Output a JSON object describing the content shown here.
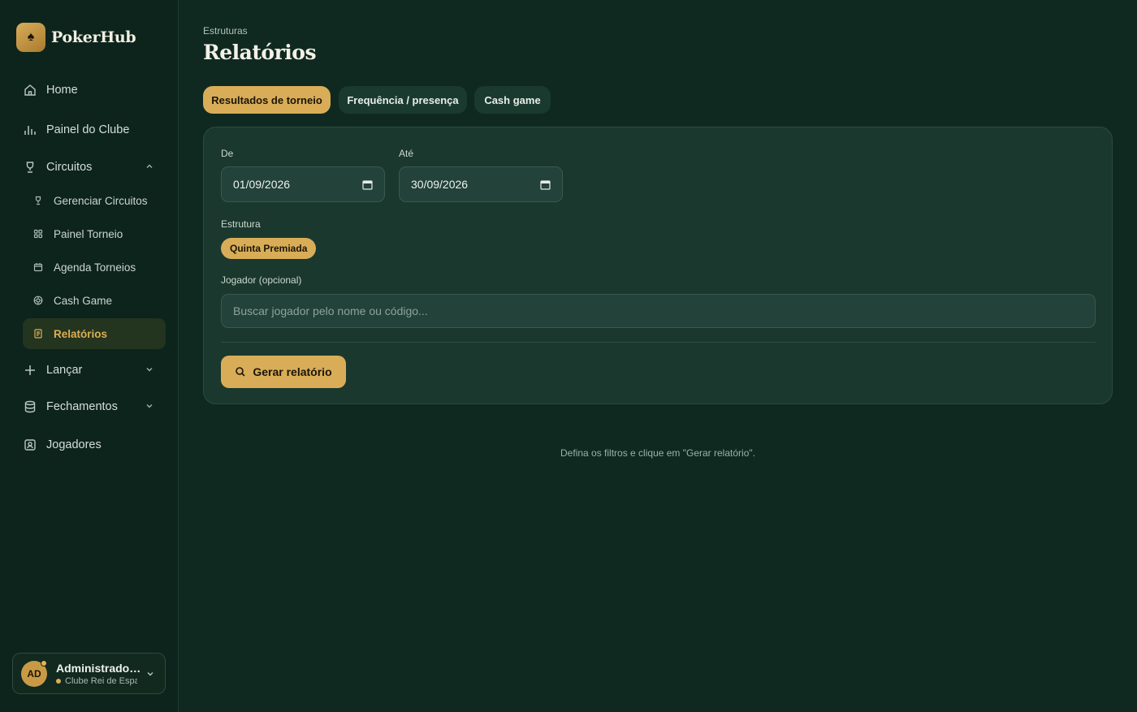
{
  "brand": {
    "name": "PokerHub",
    "icon": "spade-icon"
  },
  "sidebar": {
    "items": [
      {
        "label": "Home",
        "icon": "home-icon"
      },
      {
        "label": "Painel do Clube",
        "icon": "bar-chart-icon"
      },
      {
        "label": "Circuitos",
        "icon": "trophy-icon",
        "expanded": true
      },
      {
        "label": "Lançar",
        "icon": "plus-icon",
        "expanded": false
      },
      {
        "label": "Fechamentos",
        "icon": "database-icon",
        "expanded": false
      },
      {
        "label": "Jogadores",
        "icon": "contact-icon"
      }
    ],
    "circuitos_sub": [
      {
        "label": "Gerenciar Circuitos",
        "icon": "trophy-icon"
      },
      {
        "label": "Painel Torneio",
        "icon": "grid-icon"
      },
      {
        "label": "Agenda Torneios",
        "icon": "calendar-icon"
      },
      {
        "label": "Cash Game",
        "icon": "chip-icon"
      },
      {
        "label": "Relatórios",
        "icon": "report-icon",
        "active": true
      }
    ]
  },
  "user": {
    "initials": "AD",
    "name": "Administrador ...",
    "club": "Clube Rei de Espadas"
  },
  "page": {
    "breadcrumb": "Estruturas",
    "title": "Relatórios",
    "tabs": [
      {
        "label": "Resultados de torneio",
        "active": true
      },
      {
        "label": "Frequência / presença",
        "active": false
      },
      {
        "label": "Cash game",
        "active": false
      }
    ]
  },
  "filters": {
    "from_label": "De",
    "from_value": "01/09/2026",
    "to_label": "Até",
    "to_value": "30/09/2026",
    "structure_label": "Estrutura",
    "structure_chip": "Quinta Premiada",
    "player_label": "Jogador (opcional)",
    "player_placeholder": "Buscar jogador pelo nome ou código...",
    "generate_label": "Gerar relatório"
  },
  "empty_hint": "Defina os filtros e clique em \"Gerar relatório\".",
  "colors": {
    "background": "#0f2920",
    "sidebar": "#0d241c",
    "accent": "#d9ad57",
    "card": "#1a382d"
  }
}
